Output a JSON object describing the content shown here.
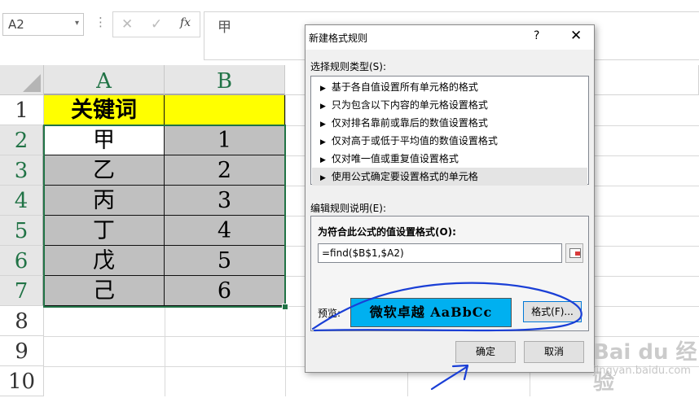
{
  "formula_bar": {
    "name_box": "A2",
    "name_box_arrow": "▾",
    "separator": "⋮",
    "cancel_glyph": "✕",
    "enter_glyph": "✓",
    "fx_label": "fx",
    "formula_value": "甲"
  },
  "sheet": {
    "columns": [
      "A",
      "B"
    ],
    "rows": [
      "1",
      "2",
      "3",
      "4",
      "5",
      "6",
      "7",
      "8",
      "9",
      "10"
    ],
    "cells": [
      {
        "a": "关键词",
        "b": ""
      },
      {
        "a": "甲",
        "b": "1"
      },
      {
        "a": "乙",
        "b": "2"
      },
      {
        "a": "丙",
        "b": "3"
      },
      {
        "a": "丁",
        "b": "4"
      },
      {
        "a": "戊",
        "b": "5"
      },
      {
        "a": "己",
        "b": "6"
      }
    ],
    "colors": {
      "header_fill": "#ffff00",
      "formatted_fill": "#c0c0c0",
      "selection": "#217346"
    }
  },
  "dialog": {
    "title": "新建格式规则",
    "help": "?",
    "close": "✕",
    "rule_type_label": "选择规则类型(S):",
    "rule_types": [
      "基于各自值设置所有单元格的格式",
      "只为包含以下内容的单元格设置格式",
      "仅对排名靠前或靠后的数值设置格式",
      "仅对高于或低于平均值的数值设置格式",
      "仅对唯一值或重复值设置格式",
      "使用公式确定要设置格式的单元格"
    ],
    "selected_rule_index": 5,
    "edit_desc_label": "编辑规则说明(E):",
    "formula_label": "为符合此公式的值设置格式(O):",
    "formula_value": "=find($B$1,$A2)",
    "preview_label": "预览:",
    "preview_text": "微软卓越    AaBbCc",
    "preview_fill": "#00b0f0",
    "format_button": "格式(F)...",
    "ok_button": "确定",
    "cancel_button": "取消"
  },
  "watermark": {
    "brand": "Bai du 经验",
    "url": "jingyan.baidu.com"
  },
  "annotation_color": "#1a3fd6"
}
